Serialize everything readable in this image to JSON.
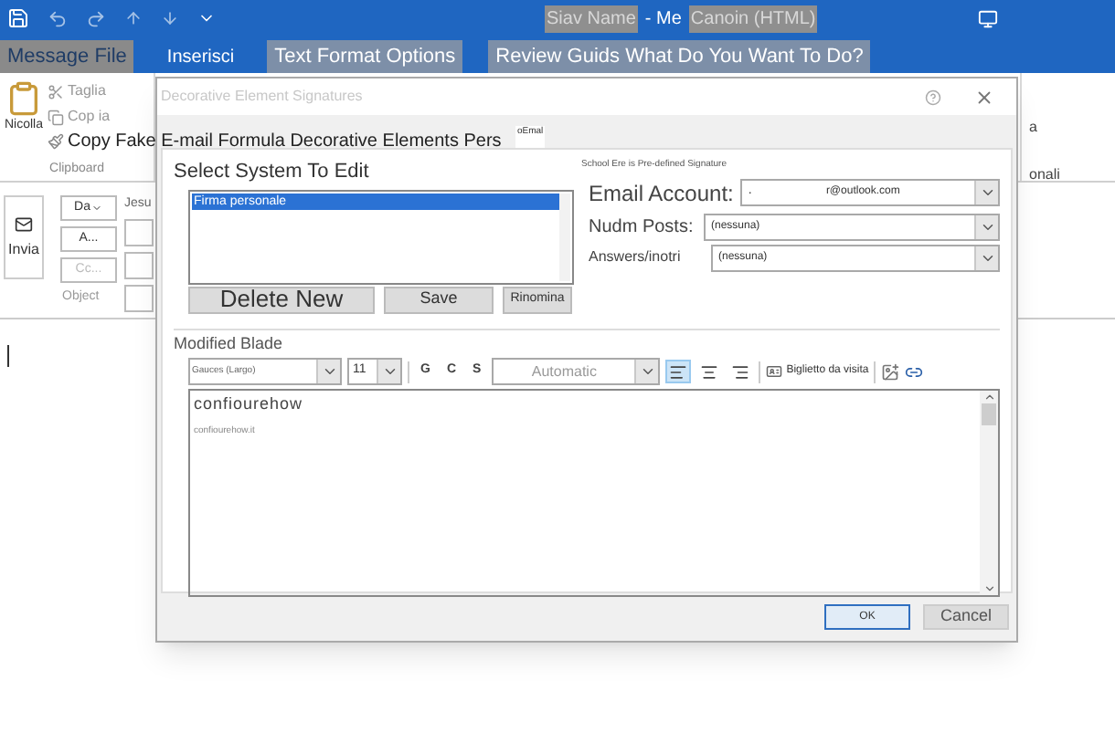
{
  "title_bar": {
    "title_parts": [
      {
        "text": "Siav Name",
        "highlighted": true
      },
      {
        "text": "- Me",
        "highlighted": false
      },
      {
        "text": "Canoin (HTML)",
        "highlighted": true
      }
    ]
  },
  "ribbon_tabs": [
    {
      "label": "Message File",
      "selected": true
    },
    {
      "label": "Inserisci",
      "selected": false
    },
    {
      "label": "Text Format Options",
      "selected": false
    },
    {
      "label": "Review Guids What Do You Want To Do?",
      "selected": false
    }
  ],
  "clipboard": {
    "paste": "Nicolla",
    "cut": "Taglia",
    "copy": "Cop ia",
    "format_painter": "Copy Fake E-mail Formula Decorative Elements Pers",
    "group": "Clipboard"
  },
  "ribbon_right": {
    "line_1": "a",
    "line_2": "onali"
  },
  "compose": {
    "send": "Invia",
    "recipient_buttons": [
      {
        "label": "Da",
        "dropdown": true,
        "disabled": false
      },
      {
        "label": "A...",
        "dropdown": false,
        "disabled": false
      },
      {
        "label": "Cc...",
        "dropdown": false,
        "disabled": true
      }
    ],
    "from_value": "Jesu",
    "subject_label": "Object"
  },
  "dialog": {
    "title": "Decorative Element Signatures",
    "tab_label": "oEmal",
    "left_heading": "Select System To Edit",
    "signatures": [
      {
        "name": "Firma personale",
        "selected": true
      }
    ],
    "signature_buttons": [
      {
        "label": "Delete New",
        "kind": "large"
      },
      {
        "label": "Save",
        "kind": "normal"
      },
      {
        "label": "Rinomina",
        "kind": "small"
      }
    ],
    "right_heading": "School Ere is Pre-defined Signature",
    "fields": [
      {
        "label": "Email Account:",
        "kind": "large",
        "prefix": ".",
        "value": "r@outlook.com"
      },
      {
        "label": "Nudm Posts:",
        "kind": "medium",
        "value": "(nessuna)"
      },
      {
        "label": "Answers/inotri",
        "kind": "small",
        "value": "(nessuna)"
      }
    ],
    "editor_heading": "Modified Blade",
    "toolbar": {
      "font": "Gauces (Largo)",
      "size": "11",
      "bold": "G",
      "italic": "C",
      "underline": "S",
      "swatch_label": "Automatic",
      "alignments": [
        {
          "kind": "left",
          "selected": true
        },
        {
          "kind": "center",
          "selected": false
        },
        {
          "kind": "right",
          "selected": false
        }
      ],
      "business_card": "Biglietto da visita"
    },
    "editor_lines": [
      {
        "text": "confiourehow",
        "kind": "large"
      },
      {
        "text": "confiourehow.it",
        "kind": "small"
      }
    ],
    "footer_buttons": [
      {
        "label": "OK",
        "default": true
      },
      {
        "label": "Cancel",
        "default": false
      }
    ]
  }
}
